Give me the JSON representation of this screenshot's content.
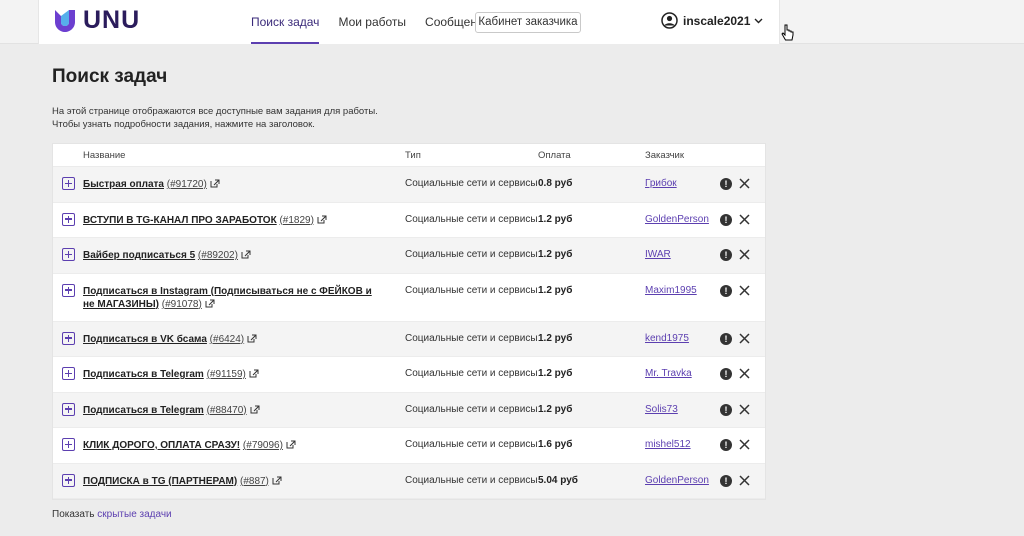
{
  "brand": {
    "logo_text": "UNU"
  },
  "nav": {
    "items": [
      {
        "label": "Поиск задач",
        "active": true
      },
      {
        "label": "Мои работы",
        "active": false
      },
      {
        "label": "Сообщения",
        "active": false
      }
    ],
    "cabinet_button": "Кабинет заказчика"
  },
  "user": {
    "name": "inscale2021"
  },
  "page": {
    "title": "Поиск задач",
    "description_line1": "На этой странице отображаются все доступные вам задания для работы.",
    "description_line2": "Чтобы узнать подробности задания, нажмите на заголовок."
  },
  "table": {
    "headers": {
      "name": "Название",
      "type": "Тип",
      "payment": "Оплата",
      "customer": "Заказчик"
    },
    "rows": [
      {
        "title": "Быстрая оплата",
        "id": "(#91720)",
        "type": "Социальные сети и сервисы",
        "payment": "0.8 руб",
        "customer": "Грибок"
      },
      {
        "title": "ВСТУПИ В TG-КАНАЛ ПРО ЗАРАБОТОК",
        "id": "(#1829)",
        "type": "Социальные сети и сервисы",
        "payment": "1.2 руб",
        "customer": "GoldenPerson"
      },
      {
        "title": "Вайбер подписаться 5",
        "id": "(#89202)",
        "type": "Социальные сети и сервисы",
        "payment": "1.2 руб",
        "customer": "IWAR"
      },
      {
        "title": "Подписаться в Instagram (Подписываться не с ФЕЙКОВ и не МАГАЗИНЫ)",
        "id": "(#91078)",
        "type": "Социальные сети и сервисы",
        "payment": "1.2 руб",
        "customer": "Maxim1995"
      },
      {
        "title": "Подписаться в VK бсама",
        "id": "(#6424)",
        "type": "Социальные сети и сервисы",
        "payment": "1.2 руб",
        "customer": "kend1975"
      },
      {
        "title": "Подписаться в Telegram",
        "id": "(#91159)",
        "type": "Социальные сети и сервисы",
        "payment": "1.2 руб",
        "customer": "Mr. Travka"
      },
      {
        "title": "Подписаться в Telegram",
        "id": "(#88470)",
        "type": "Социальные сети и сервисы",
        "payment": "1.2 руб",
        "customer": "Solis73"
      },
      {
        "title": "КЛИК ДОРОГО, ОПЛАТА СРАЗУ!",
        "id": "(#79096)",
        "type": "Социальные сети и сервисы",
        "payment": "1.6 руб",
        "customer": "mishel512"
      },
      {
        "title": "ПОДПИСКА в TG (ПАРТНЕРАМ)",
        "id": "(#887)",
        "type": "Социальные сети и сервисы",
        "payment": "5.04 руб",
        "customer": "GoldenPerson"
      }
    ],
    "report_icon_glyph": "!"
  },
  "footer": {
    "show_prefix": "Показать",
    "hidden_link": "скрытые задачи"
  },
  "colors": {
    "accent": "#5c3fb0",
    "brand_dark": "#2b1c5c",
    "background": "#ececec"
  }
}
